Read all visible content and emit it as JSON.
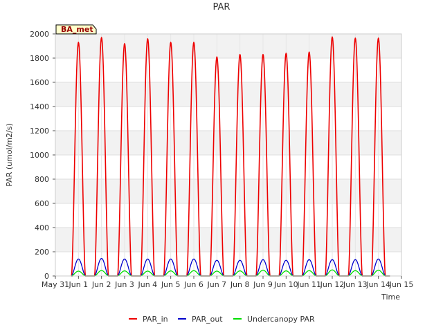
{
  "chart_data": {
    "type": "line",
    "title": "PAR",
    "xlabel": "Time",
    "ylabel": "PAR (umol/m2/s)",
    "site_label": "BA_met",
    "x_tick_labels": [
      "May 31",
      "Jun 1",
      "Jun 2",
      "Jun 3",
      "Jun 4",
      "Jun 5",
      "Jun 6",
      "Jun 7",
      "Jun 8",
      "Jun 9",
      "Jun 10",
      "Jun 11",
      "Jun 12",
      "Jun 13",
      "Jun 14",
      "Jun 15"
    ],
    "xlim": [
      0,
      15
    ],
    "ylim": [
      0,
      2000
    ],
    "y_ticks": [
      0,
      200,
      400,
      600,
      800,
      1000,
      1200,
      1400,
      1600,
      1800,
      2000
    ],
    "grid": true,
    "legend_position": "bottom",
    "days": [
      1,
      2,
      3,
      4,
      5,
      6,
      7,
      8,
      9,
      10,
      11,
      12,
      13,
      14
    ],
    "series": [
      {
        "name": "PAR_in",
        "color": "#ee0000",
        "peaks": [
          1930,
          1970,
          1920,
          1960,
          1930,
          1930,
          1810,
          1830,
          1830,
          1840,
          1850,
          1975,
          1965,
          1965
        ]
      },
      {
        "name": "PAR_out",
        "color": "#0000cc",
        "peaks": [
          140,
          145,
          140,
          140,
          140,
          140,
          130,
          130,
          135,
          130,
          135,
          135,
          135,
          140
        ]
      },
      {
        "name": "Undercanopy PAR",
        "color": "#00dd00",
        "peaks": [
          40,
          45,
          42,
          40,
          42,
          44,
          40,
          42,
          48,
          42,
          44,
          50,
          44,
          48
        ]
      }
    ]
  }
}
